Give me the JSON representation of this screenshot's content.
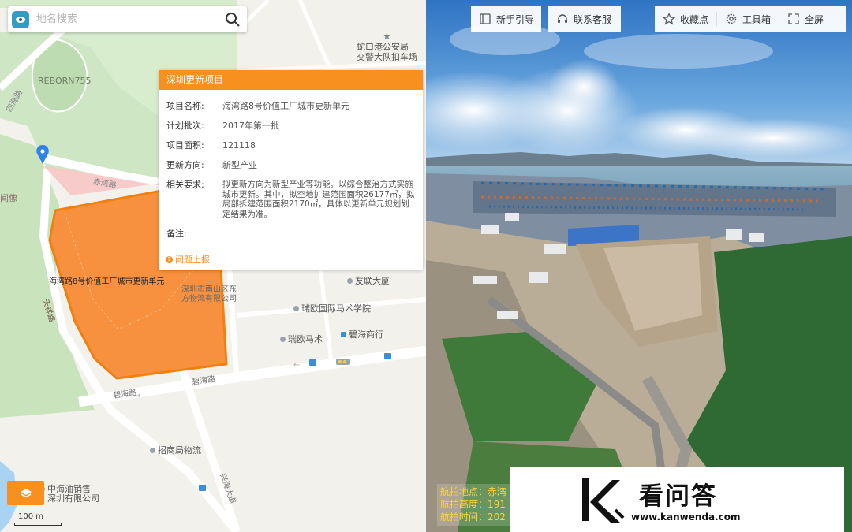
{
  "search": {
    "placeholder": "地名搜索"
  },
  "map": {
    "labels": {
      "police": "蛇口港公安局",
      "police2": "交警大队扣车场",
      "reborn": "REBORN755",
      "road_chiwan": "赤湾路",
      "road_tianxiang": "天祥路",
      "road_bihai": "碧海路",
      "road_bihai2": "碧海路",
      "road_xinghai": "兴海大道",
      "road_left": "四海路",
      "left_edge": "间像",
      "parcel": "海湾路8号价值工厂城市更新单元",
      "youlian": "友联大厦",
      "ruiou_intl": "瑞欧国际马术学院",
      "ruiou_horse": "瑞欧马术",
      "bihai_shop": "碧海商行",
      "company": "深圳市南山区东方物流有限公司",
      "zhaoshang": "招商局物流",
      "zhonghai": "中海油销售",
      "zhonghai2": "深圳有限公司",
      "scale": "100 m"
    }
  },
  "popup": {
    "title": "深圳更新项目",
    "rows": [
      {
        "k": "项目名称:",
        "v": "海湾路8号价值工厂城市更新单元"
      },
      {
        "k": "计划批次:",
        "v": "2017年第一批"
      },
      {
        "k": "项目面积:",
        "v": "121118"
      },
      {
        "k": "更新方向:",
        "v": "新型产业"
      },
      {
        "k": "相关要求:",
        "v": "拟更新方向为新型产业等功能。以综合整治方式实施城市更新。其中，拟空地扩建范围面积26177㎡，拟局部拆建范围面积2170㎡，具体以更新单元规划划定结果为准。"
      },
      {
        "k": "备注:",
        "v": ""
      }
    ],
    "footer": "问题上报"
  },
  "pano": {
    "toolbar1": [
      {
        "label": "新手引导",
        "icon": "book-icon"
      },
      {
        "label": "联系客服",
        "icon": "headset-icon"
      }
    ],
    "toolbar2": [
      {
        "label": "收藏点",
        "icon": "star-icon"
      },
      {
        "label": "工具箱",
        "icon": "gear-icon"
      },
      {
        "label": "全屏",
        "icon": "fullscreen-icon"
      }
    ],
    "info": [
      "航拍地点：赤湾",
      "航拍高度：191",
      "航拍时间：202"
    ]
  },
  "watermark": {
    "cn": "看问答",
    "en": "www.kanwenda.com"
  },
  "colors": {
    "accent": "#f7901e",
    "parcel": "#f7913f",
    "info_text": "#ffd43a"
  }
}
